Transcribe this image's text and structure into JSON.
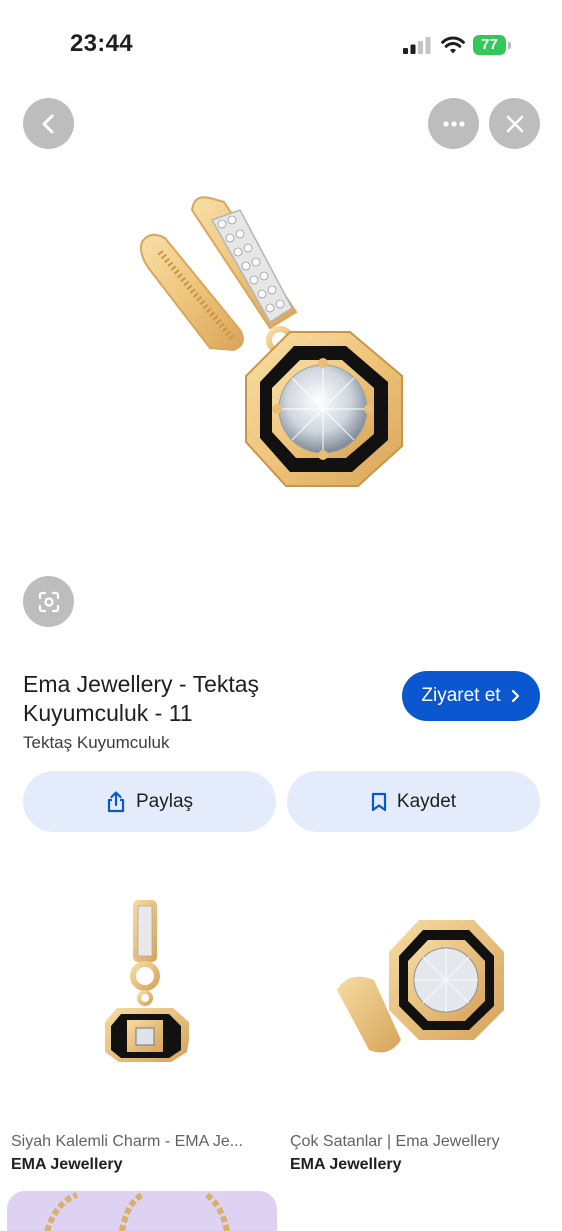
{
  "status_bar": {
    "time": "23:44",
    "battery": "77"
  },
  "icons": {
    "back": "chevron-left-icon",
    "more": "more-horizontal-icon",
    "close": "close-icon",
    "lens": "lens-search-icon",
    "share": "share-icon",
    "bookmark": "bookmark-icon",
    "visit_chevron": "chevron-right-icon"
  },
  "result": {
    "title": "Ema Jewellery - Tektaş Kuyumculuk - 11",
    "source": "Tektaş Kuyumculuk",
    "visit_label": "Ziyaret et",
    "share_label": "Paylaş",
    "save_label": "Kaydet"
  },
  "related": [
    {
      "title": "Siyah Kalemli Charm - EMA Je...",
      "source": "EMA Jewellery"
    },
    {
      "title": "Çok Satanlar | Ema Jewellery",
      "source": "EMA Jewellery"
    }
  ],
  "colors": {
    "accent": "#0b57d0",
    "pill_bg": "#e4ecfb",
    "gold": "#f0c77d",
    "enamel": "#111111"
  }
}
